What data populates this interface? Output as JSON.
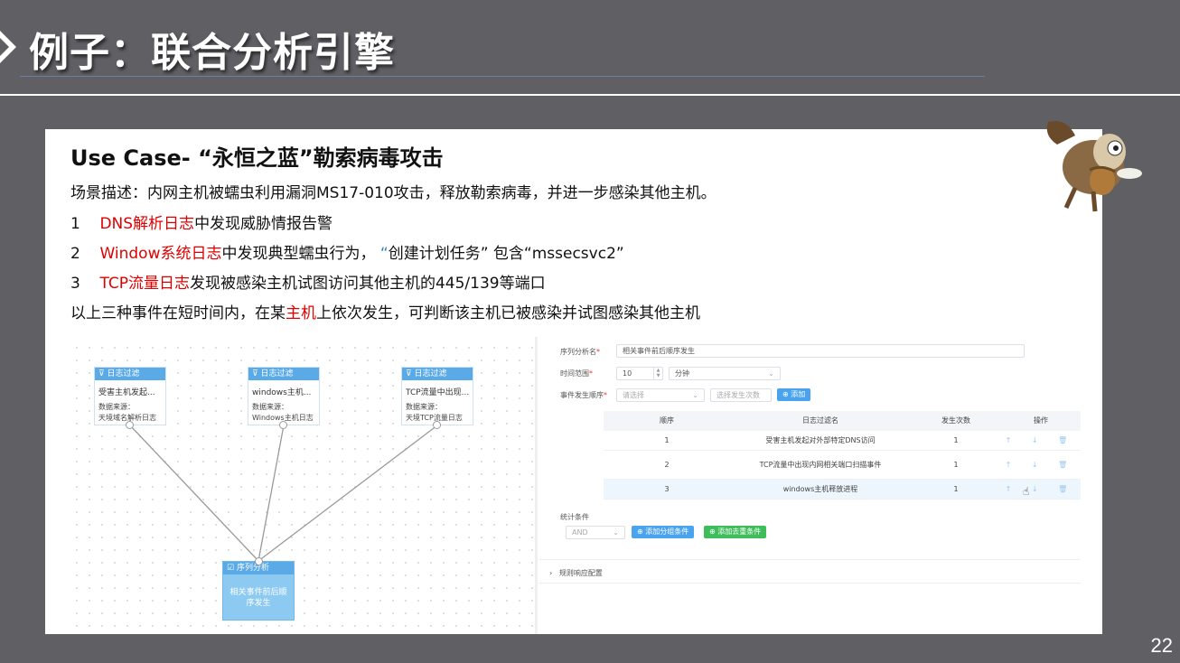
{
  "slide": {
    "title": "例子：联合分析引擎",
    "page_number": "22"
  },
  "case": {
    "title": "Use Case- “永恒之蓝”勒索病毒攻击",
    "scenario": "场景描述：内网主机被蠕虫利用漏洞MS17-010攻击，释放勒索病毒，并进一步感染其他主机。",
    "item1": {
      "num": "1",
      "red": "DNS解析日志",
      "rest": "中发现威胁情报告警"
    },
    "item2": {
      "num": "2",
      "red": "Window系统日志",
      "mid": "中发现典型蠕虫行为，",
      "blue_quote": "“",
      "quoted": "创建计划任务”",
      "tail": " 包含“mssecsvc2”"
    },
    "item3": {
      "num": "3",
      "red": "TCP流量日志",
      "rest": "发现被感染主机试图访问其他主机的445/139等端口"
    },
    "conclusion": {
      "pre": "以上三种事件在短时间内，在某",
      "red": "主机",
      "post": "上依次发生，可判断该主机已被感染并试图感染其他主机"
    }
  },
  "flow": {
    "nodes": [
      {
        "header": "日志过滤",
        "name": "受害主机发起...",
        "src_label": "数据来源：",
        "src": "天境域名解析日志"
      },
      {
        "header": "日志过滤",
        "name": "windows主机...",
        "src_label": "数据来源：",
        "src": "Windows主机日志"
      },
      {
        "header": "日志过滤",
        "name": "TCP流量中出现...",
        "src_label": "数据来源：",
        "src": "天境TCP流量日志"
      }
    ],
    "sequence": {
      "header": "序列分析",
      "body": "相关事件前后顺序发生"
    }
  },
  "form": {
    "name_label": "序列分析名",
    "name_value": "相关事件前后顺序发生",
    "time_label": "时间范围",
    "time_value": "10",
    "time_unit": "分钟",
    "order_label": "事件发生顺序",
    "order_placeholder": "请选择",
    "count_placeholder": "选择发生次数",
    "add_label": "⊕ 添加",
    "table_headers": [
      "顺序",
      "日志过滤名",
      "发生次数",
      "操作"
    ],
    "rows": [
      {
        "order": "1",
        "name": "受害主机发起对外部特定DNS访问",
        "count": "1"
      },
      {
        "order": "2",
        "name": "TCP流量中出现内网相关端口扫描事件",
        "count": "1"
      },
      {
        "order": "3",
        "name": "windows主机释放进程",
        "count": "1"
      }
    ],
    "ops_icons": "↑ ↓ 🗑",
    "stats_label": "统计条件",
    "stats_select": "AND",
    "add_group_label": "⊕ 添加分组条件",
    "add_dedup_label": "⊕ 添加去重条件",
    "rule_config_label": "规则响应配置"
  }
}
